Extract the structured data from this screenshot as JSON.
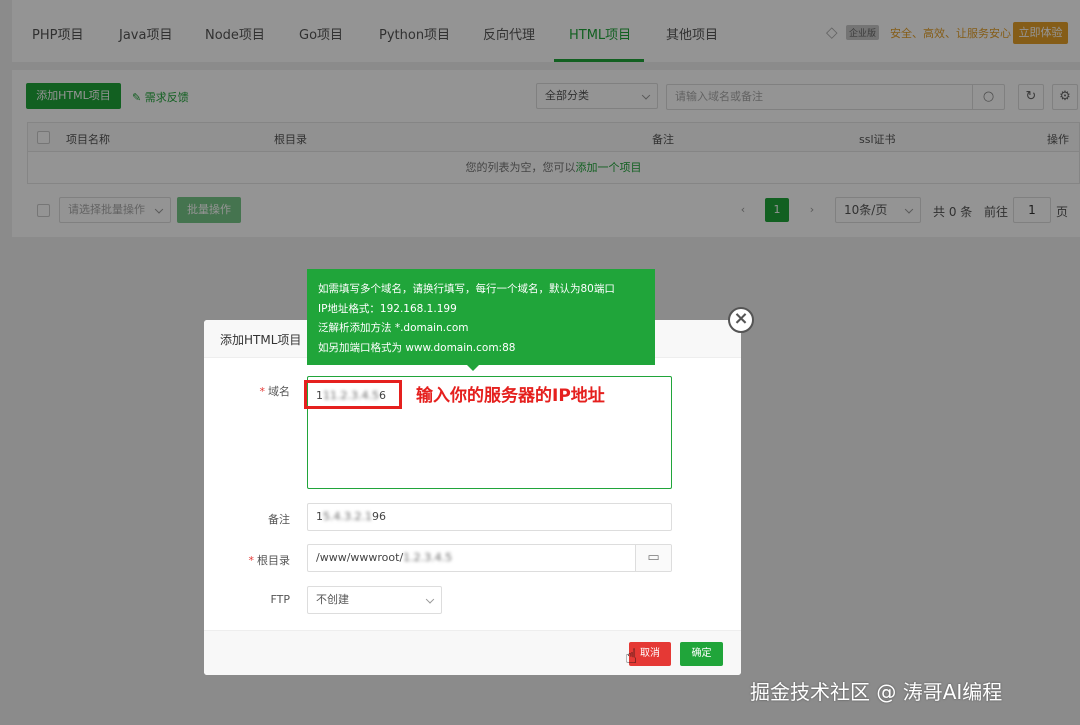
{
  "nav": {
    "tabs": [
      "PHP项目",
      "Java项目",
      "Node项目",
      "Go项目",
      "Python项目",
      "反向代理",
      "HTML项目",
      "其他项目"
    ],
    "active_tab": "HTML项目",
    "enterprise_badge": "企业版",
    "enterprise_slogan": "安全、高效、让服务安心",
    "enterprise_button": "立即体验"
  },
  "toolbar": {
    "add_button": "添加HTML项目",
    "feedback_link": "需求反馈",
    "category_select": "全部分类",
    "search_placeholder": "请输入域名或备注"
  },
  "table": {
    "headers": [
      "项目名称",
      "根目录",
      "备注",
      "ssl证书",
      "操作"
    ],
    "empty_text": "您的列表为空，您可以",
    "empty_link": "添加一个项目",
    "batch_select": "请选择批量操作",
    "batch_button": "批量操作"
  },
  "pagination": {
    "current_page": "1",
    "per_page": "10条/页",
    "total": "共 0 条",
    "goto_label": "前往",
    "goto_value": "1",
    "page_suffix": "页"
  },
  "dialog": {
    "title": "添加HTML项目",
    "domain_label": "域名",
    "domain_value_start": "1",
    "domain_value_blur": "11.2.3.4.5",
    "domain_value_end": "6",
    "remark_label": "备注",
    "remark_value_start": "1",
    "remark_value_blur": "5.4.3.2.1",
    "remark_value_end": "96",
    "root_label": "根目录",
    "root_value": "/www/wwwroot/",
    "root_value_blur": "1.2.3.4.5",
    "ftp_label": "FTP",
    "ftp_value": "不创建",
    "cancel_button": "取消",
    "ok_button": "确定"
  },
  "tooltip": {
    "lines": [
      "如需填写多个域名，请换行填写，每行一个域名，默认为80端口",
      "IP地址格式：192.168.1.199",
      "泛解析添加方法 *.domain.com",
      "如另加端口格式为 www.domain.com:88"
    ]
  },
  "annotation": {
    "text": "输入你的服务器的IP地址"
  },
  "watermark": "掘金技术社区 @ 涛哥AI编程"
}
